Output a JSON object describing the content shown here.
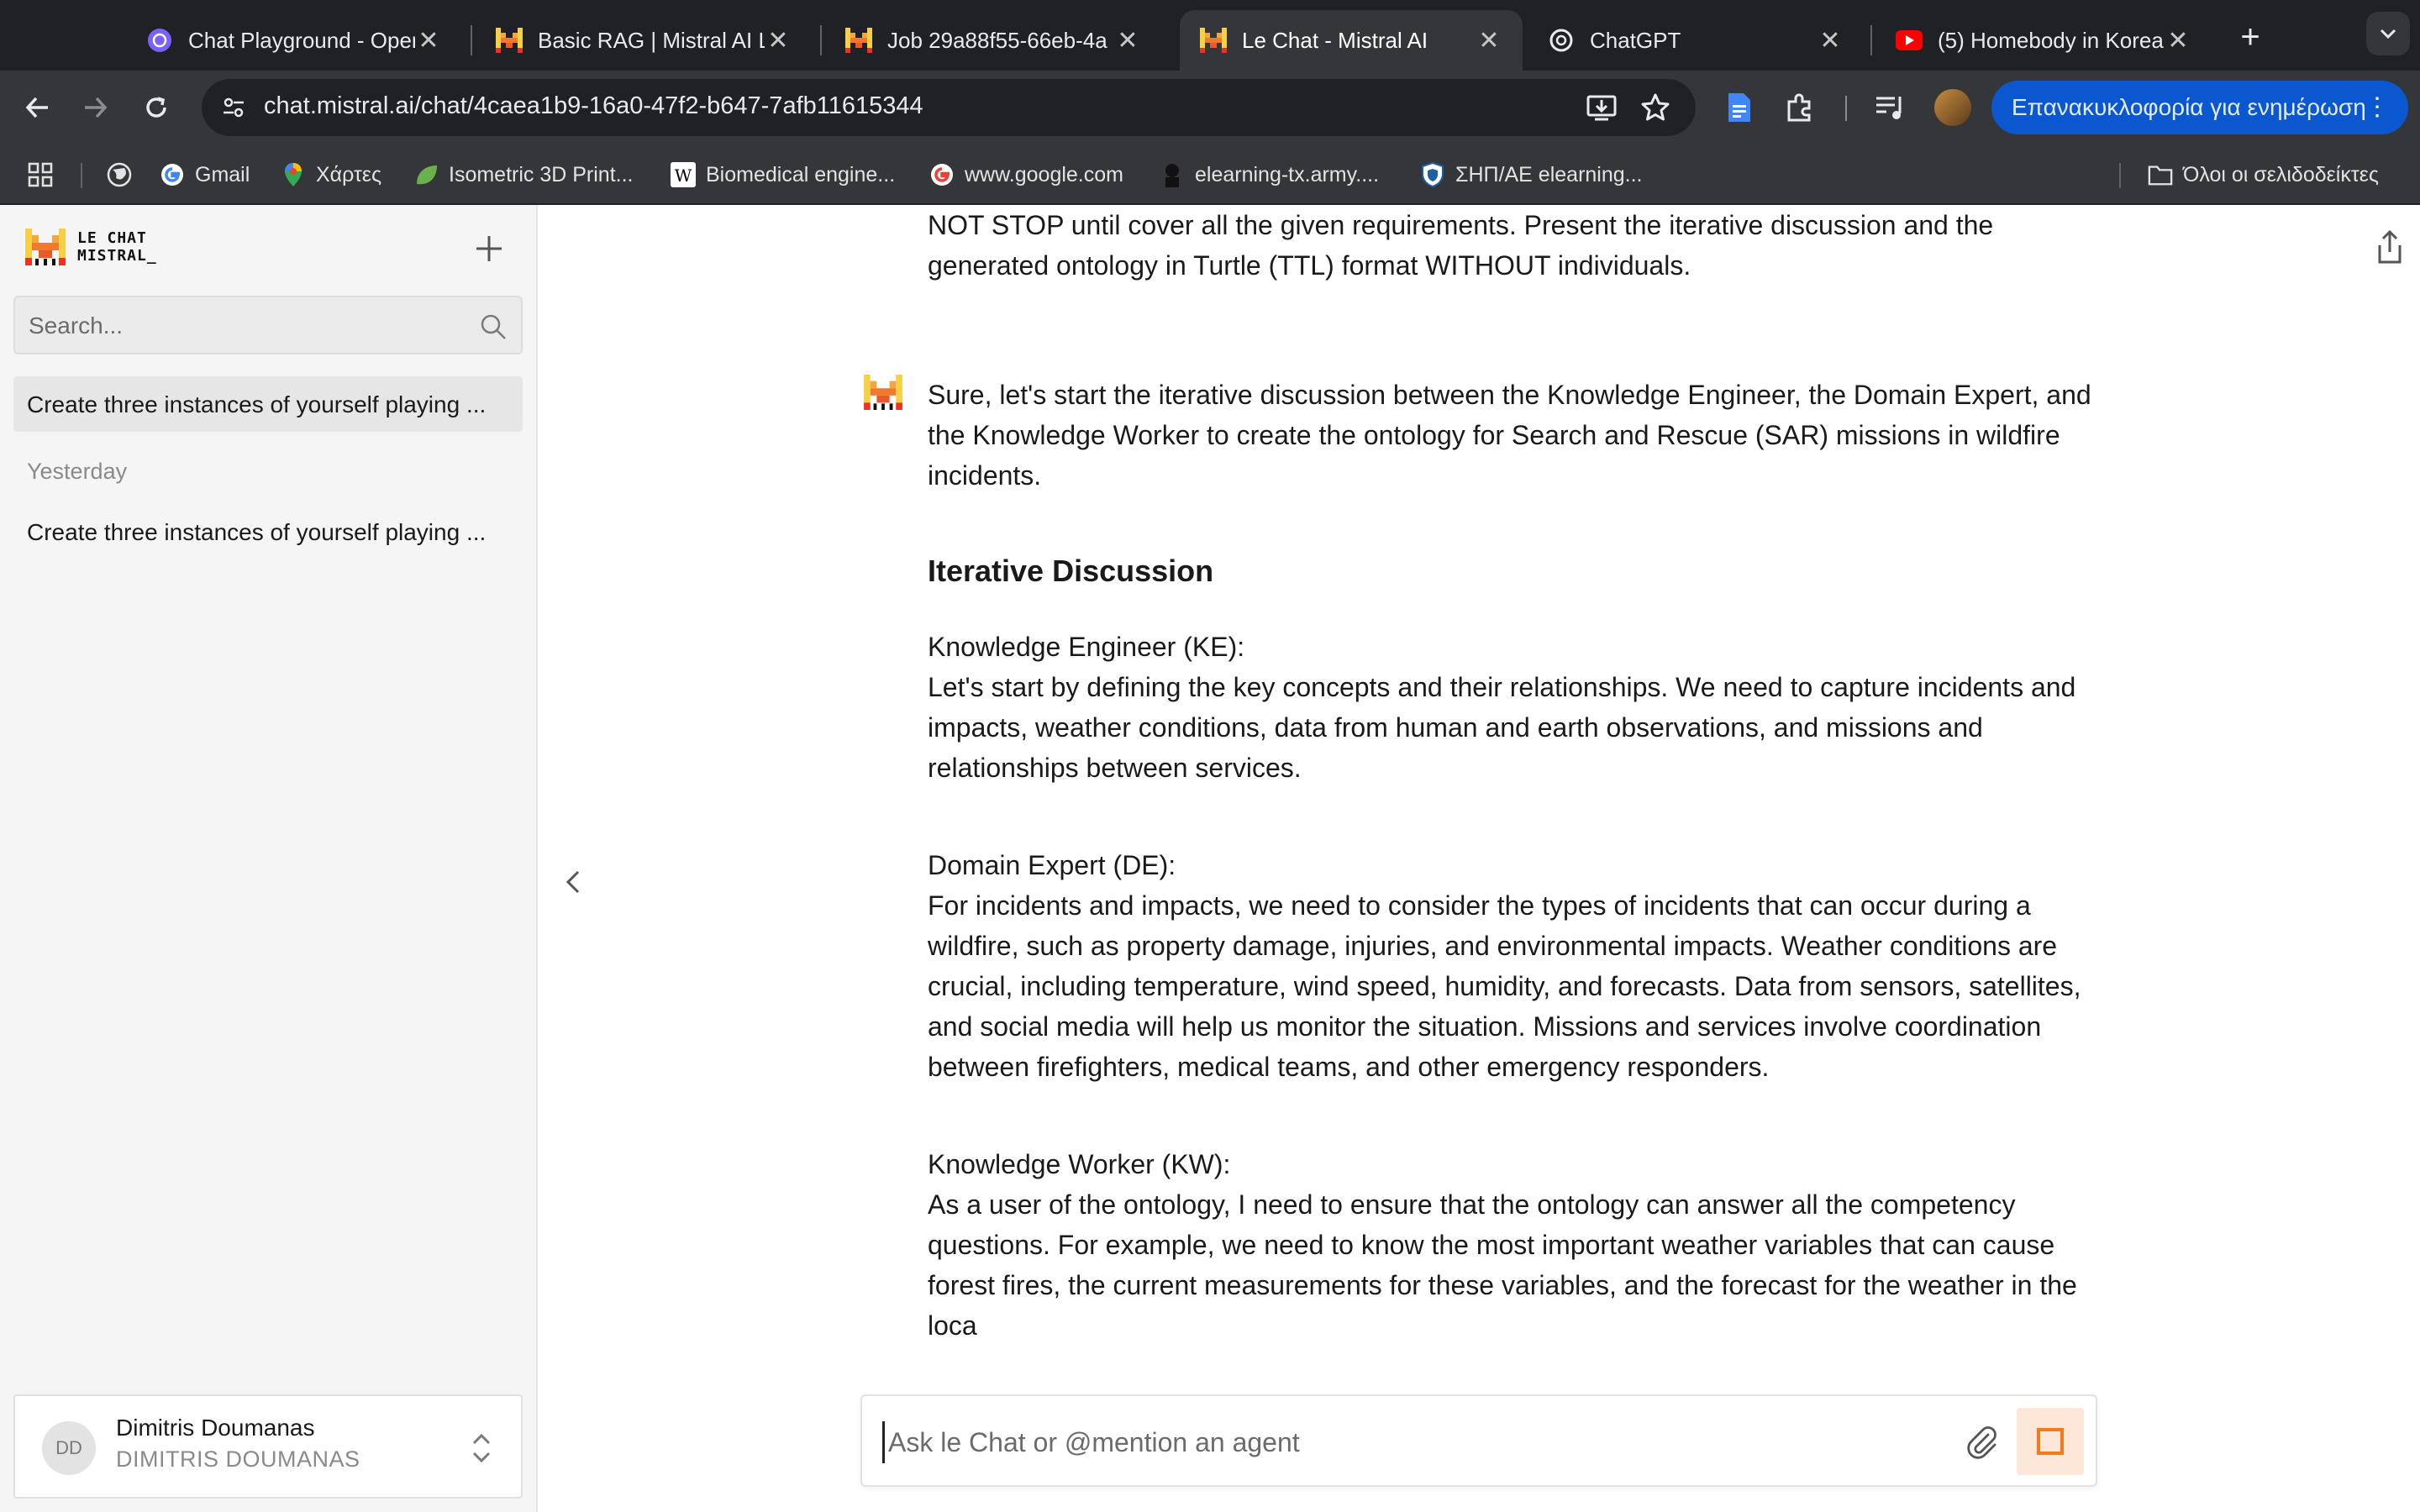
{
  "browser": {
    "tabs": [
      {
        "title": "Chat Playground - Open",
        "icon": "openai-icon"
      },
      {
        "title": "Basic RAG | Mistral AI La",
        "icon": "mistral-icon"
      },
      {
        "title": "Job 29a88f55-66eb-4a",
        "icon": "mistral-icon"
      },
      {
        "title": "Le Chat - Mistral AI",
        "icon": "mistral-icon",
        "active": true
      },
      {
        "title": "ChatGPT",
        "icon": "openai-icon"
      },
      {
        "title": "(5) Homebody in Korea",
        "icon": "youtube-icon"
      }
    ],
    "url": "chat.mistral.ai/chat/4caea1b9-16a0-47f2-b647-7afb11615344",
    "relaunch_label": "Επανακυκλοφορία για ενημέρωση",
    "bookmarks": [
      {
        "label": "Gmail",
        "icon": "google-icon"
      },
      {
        "label": "Χάρτες",
        "icon": "maps-icon"
      },
      {
        "label": "Isometric 3D Print...",
        "icon": "leaf-icon"
      },
      {
        "label": "Biomedical engine...",
        "icon": "wikipedia-icon"
      },
      {
        "label": "www.google.com",
        "icon": "google-icon"
      },
      {
        "label": "elearning-tx.army....",
        "icon": "soldier-icon"
      },
      {
        "label": "ΣΗΠ/ΑΕ elearning...",
        "icon": "shield-icon"
      }
    ],
    "all_bookmarks_label": "Όλοι οι σελιδοδείκτες"
  },
  "sidebar": {
    "logo_line1": "LE CHAT",
    "logo_line2": "MISTRAL_",
    "search_placeholder": "Search...",
    "today_item": "Create three instances of yourself playing ...",
    "section_yesterday": "Yesterday",
    "yesterday_item": "Create three instances of yourself playing ...",
    "user": {
      "initials": "DD",
      "name": "Dimitris Doumanas",
      "org": "DIMITRIS DOUMANAS"
    }
  },
  "chat": {
    "user_msg_line1": "NOT STOP until cover all the given requirements. Present the iterative discussion and the",
    "user_msg_line2": "generated ontology in Turtle (TTL) format WITHOUT individuals.",
    "intro": "Sure, let's start the iterative discussion between the Knowledge Engineer, the Domain Expert, and the Knowledge Worker to create the ontology for Search and Rescue (SAR) missions in wildfire incidents.",
    "heading": "Iterative Discussion",
    "ke_title": "Knowledge Engineer (KE):",
    "ke_text": "Let's start by defining the key concepts and their relationships. We need to capture incidents and impacts, weather conditions, data from human and earth observations, and missions and relationships between services.",
    "de_title": "Domain Expert (DE):",
    "de_text": "For incidents and impacts, we need to consider the types of incidents that can occur during a wildfire, such as property damage, injuries, and environmental impacts. Weather conditions are crucial, including temperature, wind speed, humidity, and forecasts. Data from sensors, satellites, and social media will help us monitor the situation. Missions and services involve coordination between firefighters, medical teams, and other emergency responders.",
    "kw_title": "Knowledge Worker (KW):",
    "kw_text": "As a user of the ontology, I need to ensure that the ontology can answer all the competency questions. For example, we need to know the most important weather variables that can cause forest fires, the current measurements for these variables, and the forecast for the weather in the loca",
    "composer_placeholder": "Ask le Chat or @mention an agent"
  },
  "colors": {
    "mistral_orange": "#f07a1e",
    "chrome_dark": "#202124",
    "chrome_toolbar": "#35363a",
    "relaunch_blue": "#0b57d0"
  }
}
